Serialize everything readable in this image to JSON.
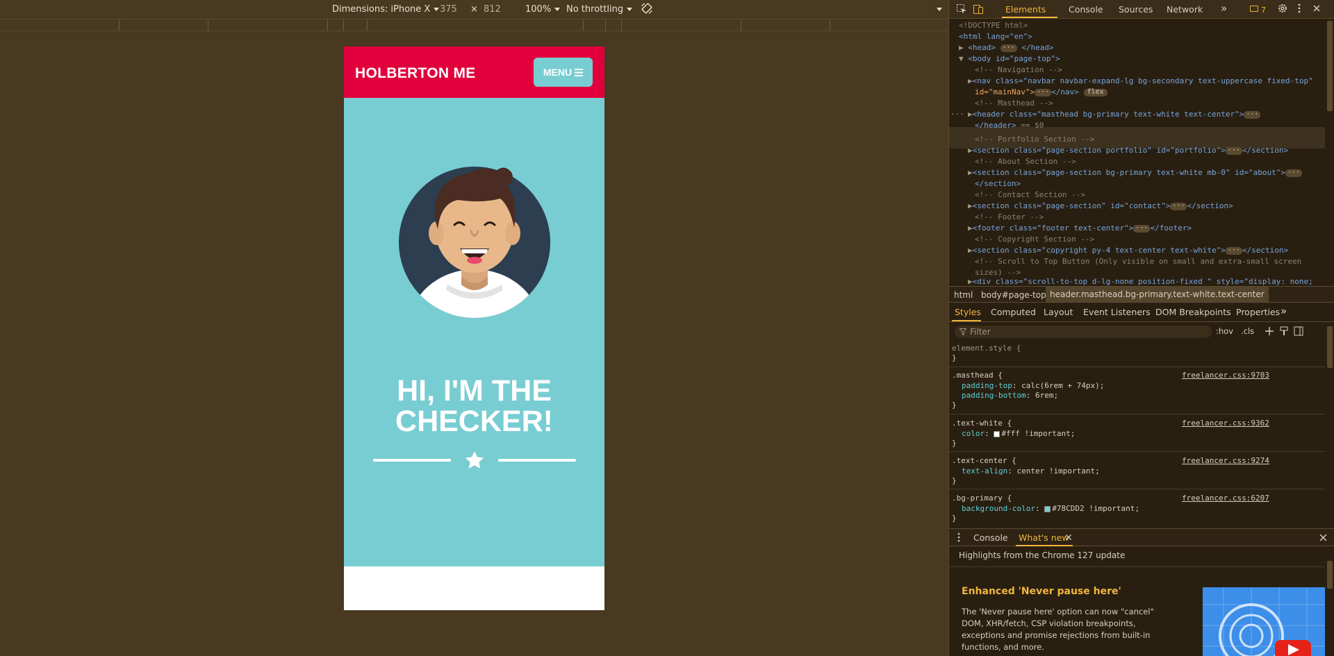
{
  "device_toolbar": {
    "dimensions_label": "Dimensions: iPhone X",
    "width": "375",
    "times": "×",
    "height": "812",
    "zoom": "100%",
    "throttling": "No throttling"
  },
  "page": {
    "brand": "HOLBERTON ME",
    "menu_label": "MENU",
    "hero_line1": "HI, I'M THE",
    "hero_line2": "CHECKER!",
    "colors": {
      "nav_bg": "#e1003c",
      "masthead_bg": "#78CDD2",
      "accent": "#f2b53d"
    }
  },
  "devtools": {
    "tabs": [
      "Elements",
      "Console",
      "Sources",
      "Network"
    ],
    "more_tabs": "»",
    "issues_count": "7",
    "dom_lines": [
      "<!DOCTYPE html>",
      "<html lang=\"en\">",
      "<head>",
      "</head>",
      "<body id=\"page-top\">",
      "<!-- Navigation -->",
      "<nav class=\"navbar navbar-expand-lg bg-secondary text-uppercase fixed-top\"",
      "id=\"mainNav\">",
      "</nav>",
      "flex",
      "<!-- Masthead -->",
      "<header class=\"masthead bg-primary text-white text-center\">",
      "</header>",
      "== $0",
      "<!-- Portfolio Section -->",
      "<section class=\"page-section portfolio\" id=\"portfolio\">",
      "</section>",
      "<!-- About Section -->",
      "<section class=\"page-section bg-primary text-white mb-0\" id=\"about\">",
      "</section>",
      "<!-- Contact Section -->",
      "<section class=\"page-section\" id=\"contact\">",
      "</section>",
      "<!-- Footer -->",
      "<footer class=\"footer text-center\">",
      "</footer>",
      "<!-- Copyright Section -->",
      "<section class=\"copyright py-4 text-center text-white\">",
      "</section>",
      "<!-- Scroll to Top Button (Only visible on small and extra-small screen",
      "sizes) -->",
      "<div class=\"scroll-to-top d-lg-none position-fixed \" style=\"display: none;"
    ],
    "breadcrumbs": [
      "html",
      "body#page-top",
      "header.masthead.bg-primary.text-white.text-center"
    ],
    "styles_tabs": [
      "Styles",
      "Computed",
      "Layout",
      "Event Listeners",
      "DOM Breakpoints",
      "Properties"
    ],
    "filter_placeholder": "Filter",
    "hov": ":hov",
    "cls": ".cls",
    "rules": {
      "element_style": "element.style {",
      "close": "}",
      "masthead_sel": ".masthead {",
      "masthead_src": "freelancer.css:9703",
      "masthead_p1": "padding-top",
      "masthead_v1": ": calc(6rem + 74px);",
      "masthead_p2": "padding-bottom",
      "masthead_v2": ": 6rem;",
      "tw_sel": ".text-white {",
      "tw_src": "freelancer.css:9362",
      "tw_p": "color",
      "tw_v": "#fff !important;",
      "tc_sel": ".text-center {",
      "tc_src": "freelancer.css:9274",
      "tc_p": "text-align",
      "tc_v": ": center !important;",
      "bp_sel": ".bg-primary {",
      "bp_src": "freelancer.css:6207",
      "bp_p": "background-color",
      "bp_v": "#78CDD2 !important;",
      "colon": ": "
    },
    "drawer_tabs": [
      "Console",
      "What's new"
    ],
    "whats_new_heading": "Highlights from the Chrome 127 update",
    "feature_title": "Enhanced 'Never pause here'",
    "feature_desc": "The 'Never pause here' option can now \"cancel\" DOM, XHR/fetch, CSP violation breakpoints, exceptions and promise rejections from built-in functions, and more."
  }
}
